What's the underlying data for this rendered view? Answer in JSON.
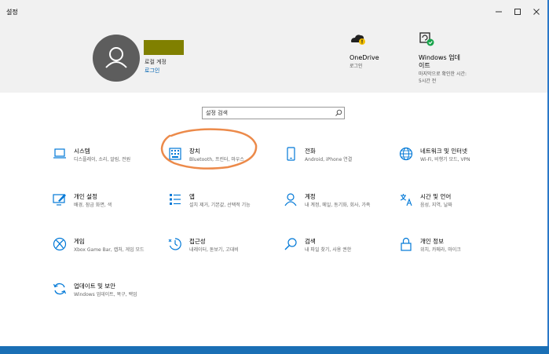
{
  "window": {
    "title": "설정",
    "controls": {
      "minimize": "—",
      "maximize": "☐",
      "close": "✕"
    }
  },
  "account": {
    "type_label": "로컬 계정",
    "sign_in_label": "로그인"
  },
  "header_items": [
    {
      "title": "OneDrive",
      "subtitle": "로그인",
      "icon": "onedrive-icon"
    },
    {
      "title": "Windows 업데이트",
      "subtitle": "마지막으로 확인한 시간: 5시간 전",
      "icon": "windows-update-icon"
    }
  ],
  "search": {
    "placeholder": "설정 검색"
  },
  "categories": [
    {
      "title": "시스템",
      "desc": "디스플레이, 소리, 알림, 전원",
      "icon": "laptop-icon"
    },
    {
      "title": "장치",
      "desc": "Bluetooth, 프린터, 마우스",
      "icon": "keyboard-icon"
    },
    {
      "title": "전화",
      "desc": "Android, iPhone 연결",
      "icon": "phone-icon"
    },
    {
      "title": "네트워크 및 인터넷",
      "desc": "Wi-Fi, 비행기 모드, VPN",
      "icon": "globe-icon"
    },
    {
      "title": "개인 설정",
      "desc": "배경, 잠금 화면, 색",
      "icon": "personalization-icon"
    },
    {
      "title": "앱",
      "desc": "설치 제거, 기본값, 선택적 기능",
      "icon": "apps-icon"
    },
    {
      "title": "계정",
      "desc": "내 계정, 메일, 동기화, 회사, 가족",
      "icon": "person-icon"
    },
    {
      "title": "시간 및 언어",
      "desc": "음성, 지역, 날짜",
      "icon": "language-icon"
    },
    {
      "title": "게임",
      "desc": "Xbox Game Bar, 캡처, 게임 모드",
      "icon": "xbox-icon"
    },
    {
      "title": "접근성",
      "desc": "내레이터, 돋보기, 고대비",
      "icon": "accessibility-icon"
    },
    {
      "title": "검색",
      "desc": "내 파일 찾기, 사용 권한",
      "icon": "magnifier-icon"
    },
    {
      "title": "개인 정보",
      "desc": "위치, 카메라, 마이크",
      "icon": "lock-icon"
    },
    {
      "title": "업데이트 및 보안",
      "desc": "Windows 업데이트, 복구, 백업",
      "icon": "refresh-icon"
    }
  ],
  "colors": {
    "accent": "#0078d7",
    "header_bg": "#f1f1f1",
    "avatar_bg": "#5d5d5d",
    "name_redaction": "#808000",
    "highlight_ring": "#ec8a4a",
    "desktop_blue": "#1a6fb5"
  }
}
